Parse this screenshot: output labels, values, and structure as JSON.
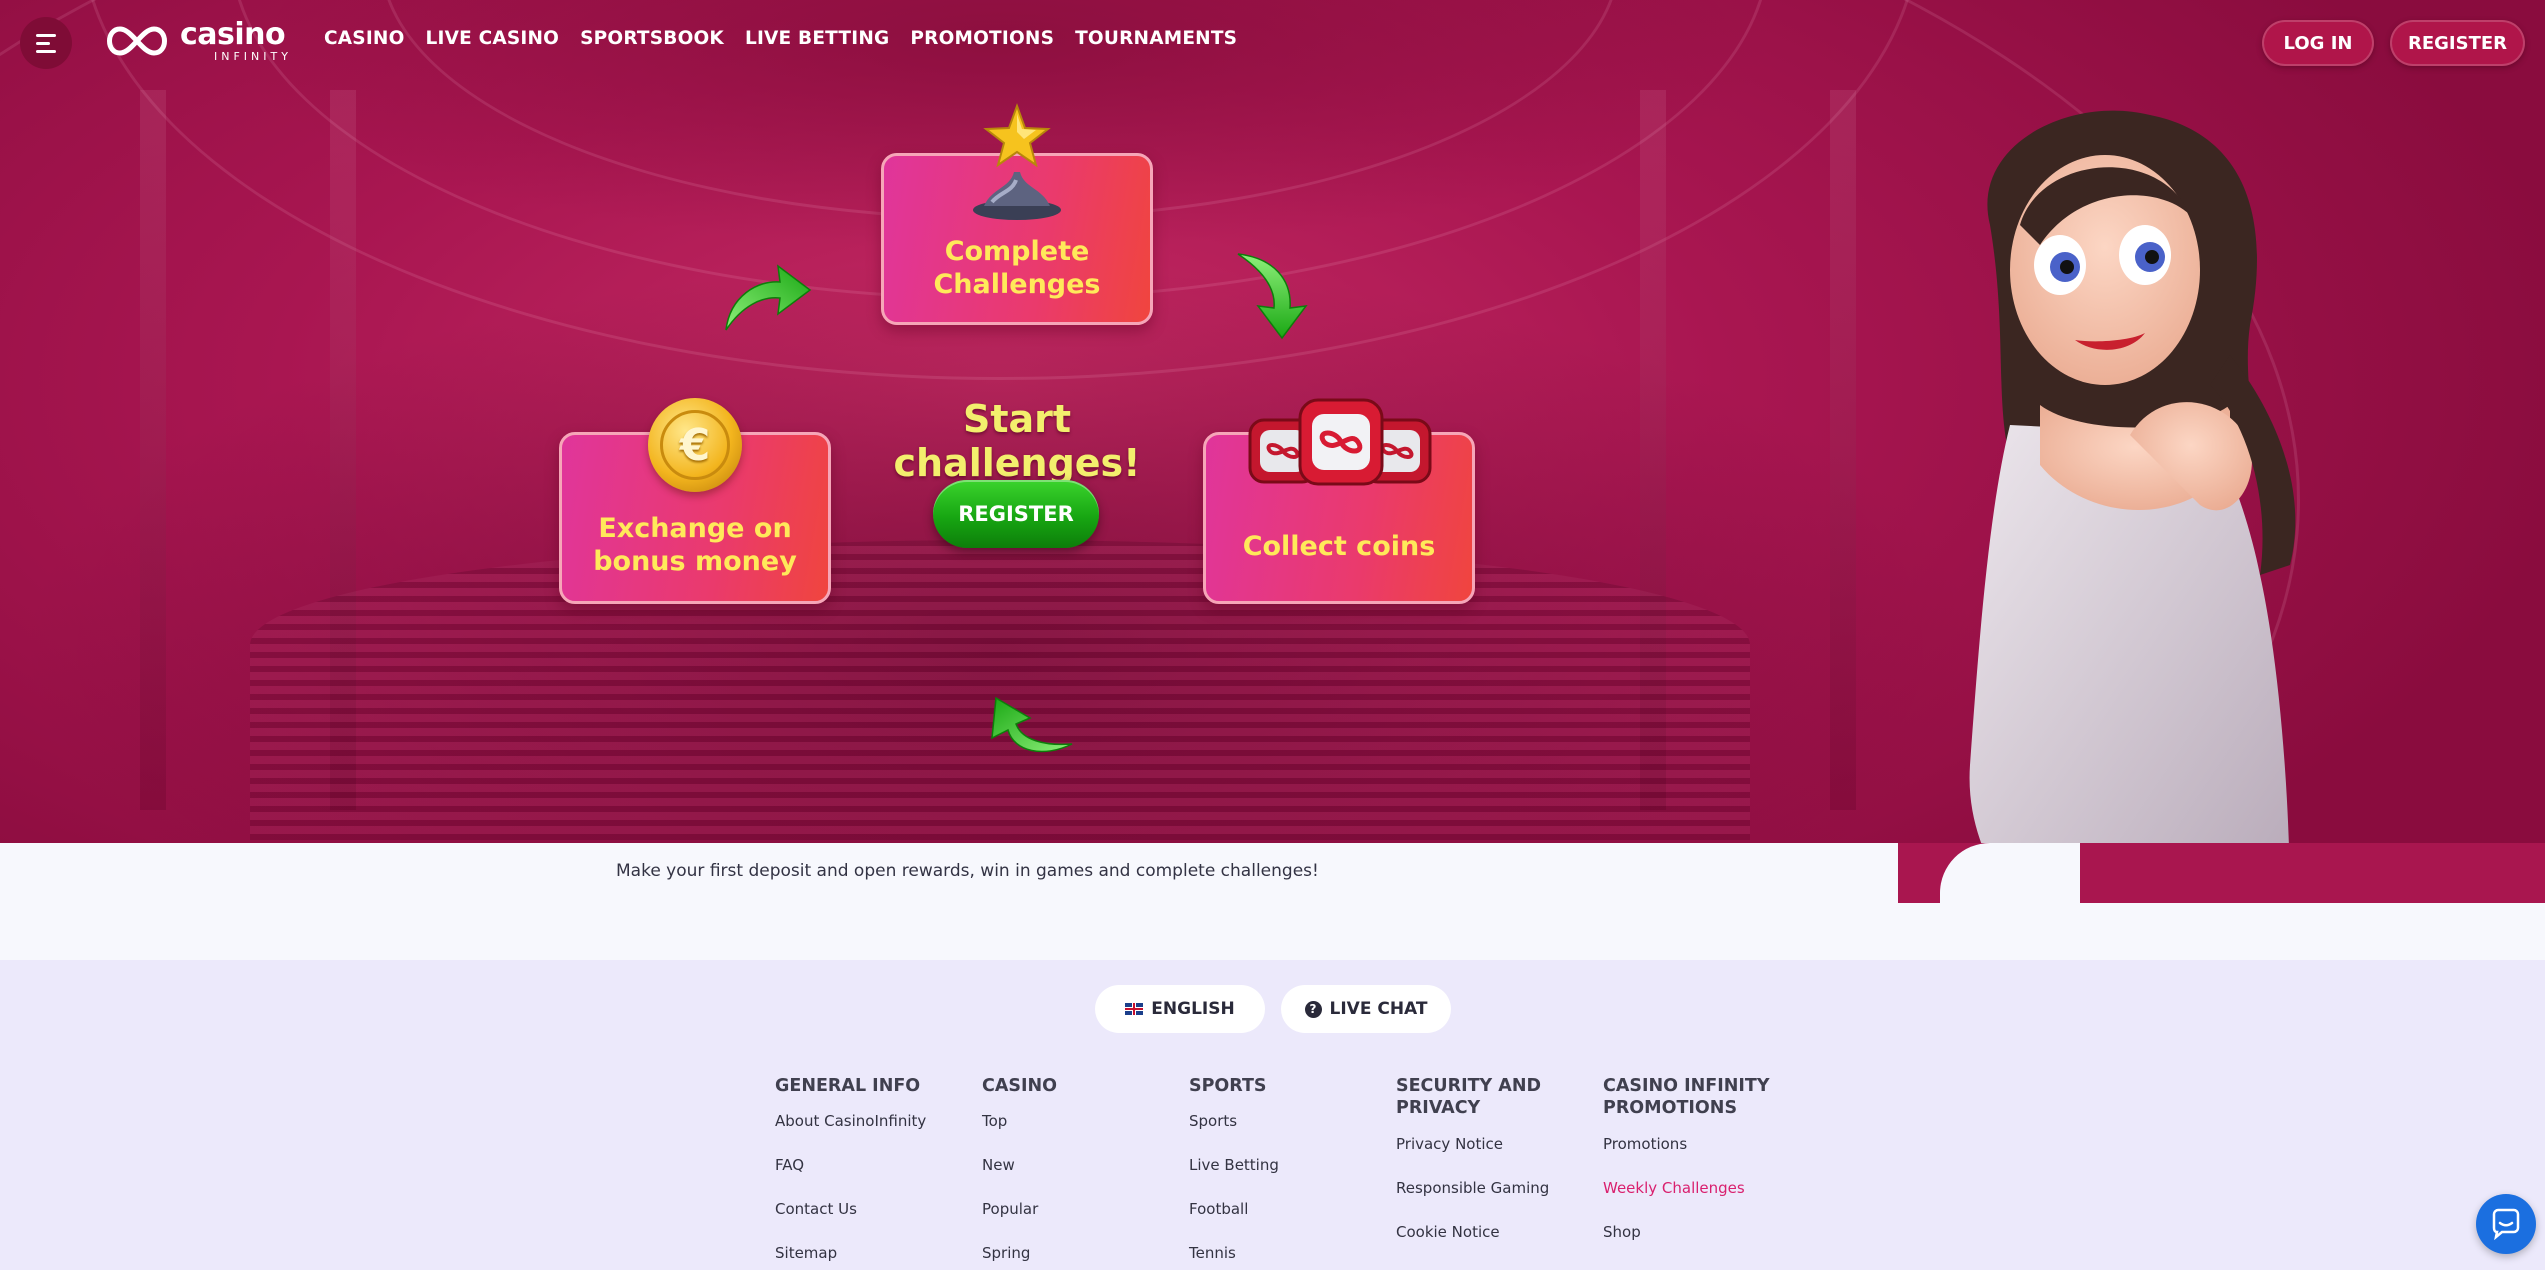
{
  "nav": {
    "logo_word": "casino",
    "logo_sub": "INFINITY",
    "links": [
      "CASINO",
      "LIVE CASINO",
      "SPORTSBOOK",
      "LIVE BETTING",
      "PROMOTIONS",
      "TOURNAMENTS"
    ],
    "login_label": "LOG IN",
    "register_label": "REGISTER"
  },
  "hero": {
    "card_top": "Complete Challenges",
    "card_left": "Exchange on bonus money",
    "card_right": "Collect coins",
    "title": "Start challenges!",
    "register_label": "REGISTER",
    "coin_symbol": "€"
  },
  "info": {
    "text": "Make your first deposit and open rewards, win in games and complete challenges!"
  },
  "footer": {
    "language_label": "ENGLISH",
    "live_chat_label": "LIVE CHAT",
    "columns": [
      {
        "title": "GENERAL INFO",
        "links": [
          "About CasinoInfinity",
          "FAQ",
          "Contact Us",
          "Sitemap"
        ]
      },
      {
        "title": "CASINO",
        "links": [
          "Top",
          "New",
          "Popular",
          "Spring"
        ]
      },
      {
        "title": "SPORTS",
        "links": [
          "Sports",
          "Live Betting",
          "Football",
          "Tennis"
        ]
      },
      {
        "title": "SECURITY AND PRIVACY",
        "links": [
          "Privacy Notice",
          "Responsible Gaming",
          "Cookie Notice"
        ]
      },
      {
        "title": "CASINO INFINITY PROMOTIONS",
        "links": [
          "Promotions",
          "Weekly Challenges",
          "Shop"
        ]
      }
    ]
  },
  "colors": {
    "hero_primary": "#a91651",
    "card_text": "#ffe95a",
    "title_text": "#f3ef6d",
    "cta_green": "#17a612",
    "active_link": "#d9206e",
    "chat_blue": "#1b6fe0"
  },
  "icons": [
    "menu-icon",
    "logo-infinity-icon",
    "star-trophy-icon",
    "euro-coin-icon",
    "casino-chips-icon",
    "green-arrow-icon",
    "uk-flag-icon",
    "question-icon",
    "chat-bubble-icon"
  ]
}
